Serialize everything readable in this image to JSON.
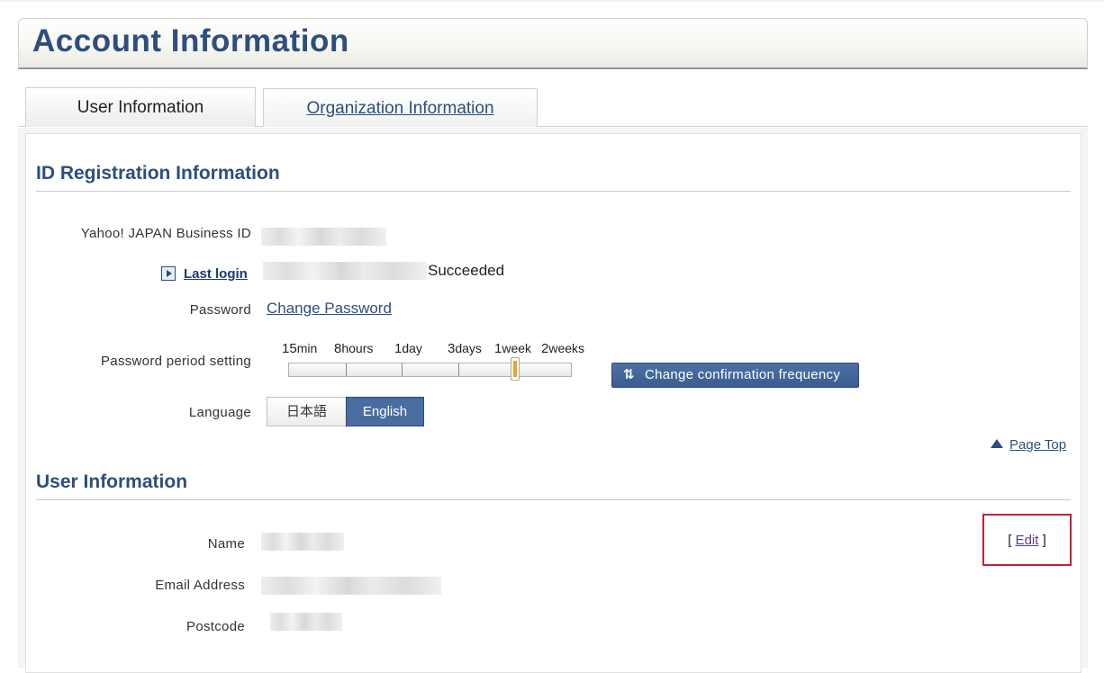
{
  "page": {
    "title": "Account Information"
  },
  "tabs": [
    {
      "label": "User Information",
      "active": true
    },
    {
      "label": "Organization Information",
      "active": false
    }
  ],
  "id_registration": {
    "title": "ID Registration Information",
    "business_id_label": "Yahoo! JAPAN Business ID",
    "last_login_label": "Last login",
    "last_login_status": "Succeeded",
    "password_label": "Password",
    "change_password_label": "Change Password",
    "password_period_label": "Password period setting",
    "slider": {
      "options": [
        {
          "num": "15",
          "unit": "min"
        },
        {
          "num": "8",
          "unit": "hours"
        },
        {
          "num": "1",
          "unit": "day"
        },
        {
          "num": "3",
          "unit": "days"
        },
        {
          "num": "1",
          "unit": "week"
        },
        {
          "num": "2",
          "unit": "weeks"
        }
      ],
      "selected": "1week"
    },
    "confirm_button_label": "Change confirmation frequency",
    "language_label": "Language",
    "language_options": [
      "日本語",
      "English"
    ],
    "language_selected": "English",
    "page_top_label": "Page Top"
  },
  "user_info": {
    "title": "User Information",
    "name_label": "Name",
    "email_label": "Email Address",
    "postcode_label": "Postcode",
    "edit_open": "[",
    "edit_label": "Edit",
    "edit_close": "]"
  },
  "colors": {
    "brand_blue": "#2d4e7e",
    "button_blue": "#4a6da0",
    "highlight_red": "#c0223a",
    "slider_accent": "#e3a81c"
  },
  "icons": [
    "play-icon",
    "refresh-icon",
    "triangle-up-icon"
  ]
}
